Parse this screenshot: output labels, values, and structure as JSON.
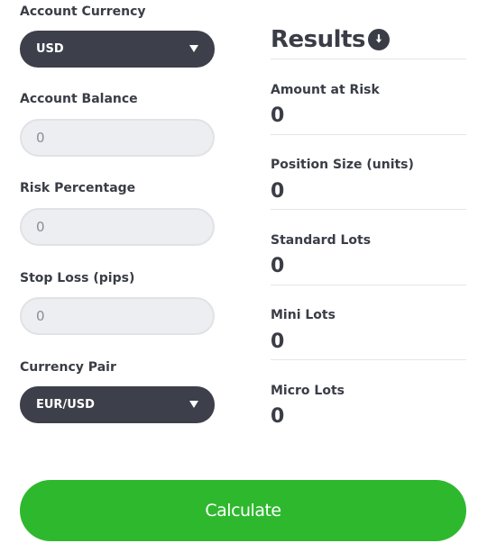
{
  "form": {
    "account_currency": {
      "label": "Account Currency",
      "selected": "USD"
    },
    "account_balance": {
      "label": "Account Balance",
      "placeholder": "0"
    },
    "risk_percentage": {
      "label": "Risk Percentage",
      "placeholder": "0"
    },
    "stop_loss": {
      "label": "Stop Loss (pips)",
      "placeholder": "0"
    },
    "currency_pair": {
      "label": "Currency Pair",
      "selected": "EUR/USD"
    }
  },
  "results": {
    "title": "Results",
    "items": [
      {
        "label": "Amount at Risk",
        "value": "0"
      },
      {
        "label": "Position Size (units)",
        "value": "0"
      },
      {
        "label": "Standard Lots",
        "value": "0"
      },
      {
        "label": "Mini Lots",
        "value": "0"
      },
      {
        "label": "Micro Lots",
        "value": "0"
      }
    ]
  },
  "actions": {
    "calculate_label": "Calculate"
  },
  "colors": {
    "select_bg": "#3d404a",
    "input_bg": "#eceef1",
    "button_green": "#2eb82e",
    "text_dark": "#3a3d46"
  },
  "icons": {
    "results_info": "arrow-down-circle-icon"
  }
}
